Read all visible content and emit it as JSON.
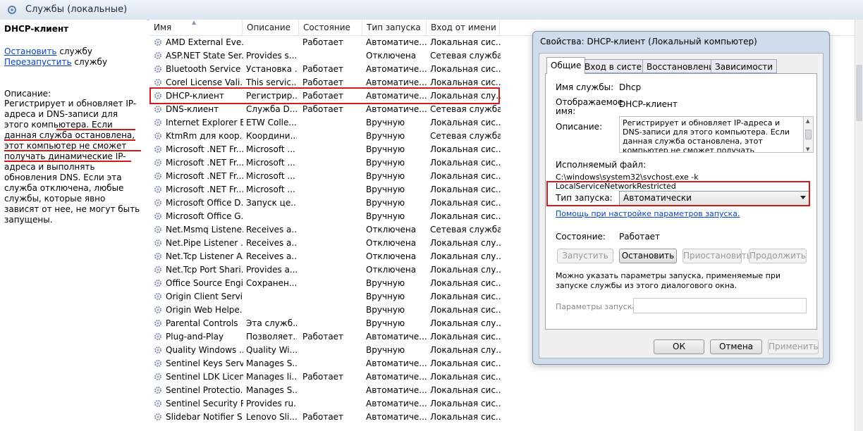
{
  "window": {
    "title": "Службы (локальные)"
  },
  "left_pane": {
    "service_name": "DHCP-клиент",
    "stop_link": "Остановить",
    "stop_suffix": " службу",
    "restart_link": "Перезапустить",
    "restart_suffix": " службу",
    "description_label": "Описание:",
    "description": "Регистрирует и обновляет IP-адреса и DNS-записи для этого компьютера. Если данная служба остановлена, этот компьютер не сможет получать динамические IP-адреса и выполнять обновления DNS. Если эта служба отключена, любые службы, которые явно зависят от нее, не могут быть запущены."
  },
  "columns": [
    "Имя",
    "Описание",
    "Состояние",
    "Тип запуска",
    "Вход от имени"
  ],
  "services": [
    [
      "AMD External Eve...",
      "",
      "Работает",
      "Автоматиче...",
      "Локальная сис..."
    ],
    [
      "ASP.NET State Ser...",
      "Provides s...",
      "",
      "Отключена",
      "Сетевая служба"
    ],
    [
      "Bluetooth Service",
      "Установка ...",
      "Работает",
      "Автоматиче...",
      "Локальная сис..."
    ],
    [
      "Corel License Vali...",
      "This servic...",
      "Работает",
      "Автоматиче...",
      "Локальная сис..."
    ],
    [
      "DHCP-клиент",
      "Регистрир...",
      "Работает",
      "Автоматиче...",
      "Локальная слу..."
    ],
    [
      "DNS-клиент",
      "Служба D...",
      "Работает",
      "Автоматиче...",
      "Сетевая служба"
    ],
    [
      "Internet Explorer E...",
      "ETW Colle...",
      "",
      "Вручную",
      "Локальная сис..."
    ],
    [
      "KtmRm для коор...",
      "Координи...",
      "",
      "Вручную",
      "Сетевая служба"
    ],
    [
      "Microsoft .NET Fr...",
      "Microsoft ...",
      "",
      "Вручную",
      "Локальная сис..."
    ],
    [
      "Microsoft .NET Fr...",
      "Microsoft ...",
      "",
      "Вручную",
      "Локальная сис..."
    ],
    [
      "Microsoft .NET Fr...",
      "Microsoft ...",
      "",
      "Вручную",
      "Локальная сис..."
    ],
    [
      "Microsoft .NET Fr...",
      "Microsoft ...",
      "",
      "Вручную",
      "Локальная сис..."
    ],
    [
      "Microsoft Office D...",
      "Запуск це...",
      "",
      "Вручную",
      "Локальная сис..."
    ],
    [
      "Microsoft Office G...",
      "",
      "",
      "Вручную",
      "Локальная сис..."
    ],
    [
      "Net.Msmq Listene...",
      "Receives a...",
      "",
      "Отключена",
      "Сетевая служба"
    ],
    [
      "Net.Pipe Listener ...",
      "Receives a...",
      "",
      "Отключена",
      "Локальная слу..."
    ],
    [
      "Net.Tcp Listener A...",
      "Receives a...",
      "",
      "Отключена",
      "Локальная слу..."
    ],
    [
      "Net.Tcp Port Shari...",
      "Provides a...",
      "",
      "Отключена",
      "Локальная слу..."
    ],
    [
      "Office Source Engi...",
      "Сохранен...",
      "",
      "Вручную",
      "Локальная сис..."
    ],
    [
      "Origin Client Servi...",
      "",
      "",
      "Вручную",
      "Локальная сис..."
    ],
    [
      "Origin Web Helpe...",
      "",
      "",
      "Вручную",
      "Локальная сис..."
    ],
    [
      "Parental Controls",
      "Эта служб...",
      "",
      "Вручную",
      "Локальная слу..."
    ],
    [
      "Plug-and-Play",
      "Позволяет...",
      "Работает",
      "Автоматиче...",
      "Локальная сис..."
    ],
    [
      "Quality Windows ...",
      "Quality Wi...",
      "",
      "Вручную",
      "Локальная слу..."
    ],
    [
      "Sentinel Keys Server",
      "Manages S...",
      "",
      "Автоматиче...",
      "Локальная сис..."
    ],
    [
      "Sentinel LDK Licen...",
      "Manages li...",
      "Работает",
      "Автоматиче...",
      "Локальная сис..."
    ],
    [
      "Sentinel Protectio...",
      "Manages S...",
      "",
      "Автоматиче...",
      "Локальная сис..."
    ],
    [
      "Sentinel Security R...",
      "Provides ru...",
      "",
      "Автоматиче...",
      "Локальная сис..."
    ],
    [
      "Slidebar Notifier S...",
      "Lenovo Sli...",
      "Работает",
      "Автоматиче...",
      "Локальная сис..."
    ]
  ],
  "dialog": {
    "title": "Свойства: DHCP-клиент (Локальный компьютер)",
    "tabs": [
      "Общие",
      "Вход в систему",
      "Восстановление",
      "Зависимости"
    ],
    "service_name_label": "Имя службы:",
    "service_name_value": "Dhcp",
    "display_name_label": "Отображаемое имя:",
    "display_name_value": "DHCP-клиент",
    "description_label": "Описание:",
    "description_value": "Регистрирует и обновляет IP-адреса и DNS-записи для этого компьютера. Если данная служба остановлена, этот компьютер не сможет получать динамические IP-адреса и",
    "exe_label": "Исполняемый файл:",
    "exe_value": "C:\\windows\\system32\\svchost.exe -k LocalServiceNetworkRestricted",
    "startup_type_label": "Тип запуска:",
    "startup_type_value": "Автоматически",
    "help_link": "Помощь при настройке параметров запуска.",
    "status_label": "Состояние:",
    "status_value": "Работает",
    "buttons": {
      "start": "Запустить",
      "stop": "Остановить",
      "pause": "Приостановить",
      "resume": "Продолжить"
    },
    "params_hint": "Можно указать параметры запуска, применяемые при запуске службы из этого диалогового окна.",
    "params_label": "Параметры запуска:",
    "footer": {
      "ok": "ОК",
      "cancel": "Отмена",
      "apply": "Применить"
    }
  },
  "colors": {
    "highlight_red": "#d11a1a",
    "link_blue": "#0645c9"
  }
}
